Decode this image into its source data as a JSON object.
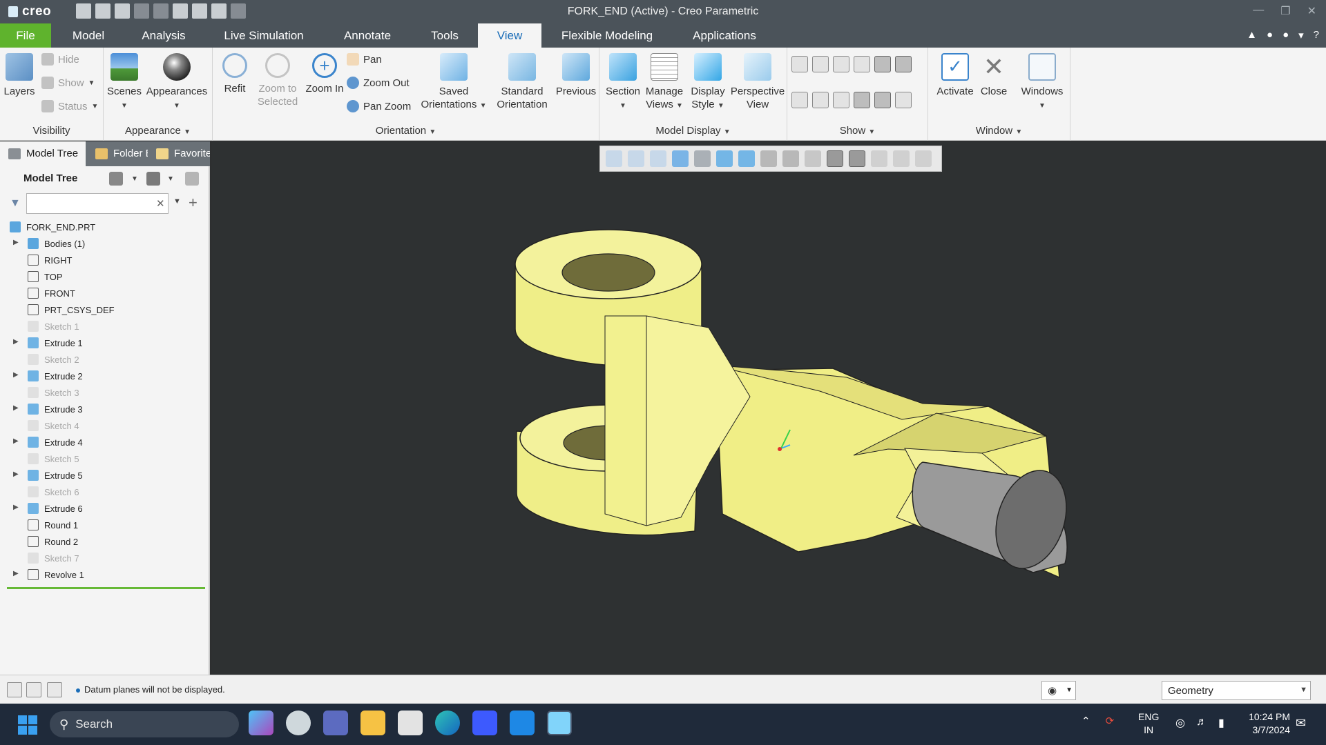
{
  "window": {
    "app_logo": "creo",
    "title": "FORK_END (Active) - Creo Parametric"
  },
  "ribbon_tabs": [
    {
      "label": "File"
    },
    {
      "label": "Model"
    },
    {
      "label": "Analysis"
    },
    {
      "label": "Live Simulation"
    },
    {
      "label": "Annotate"
    },
    {
      "label": "Tools"
    },
    {
      "label": "View"
    },
    {
      "label": "Flexible Modeling"
    },
    {
      "label": "Applications"
    }
  ],
  "active_tab": "View",
  "ribbon": {
    "visibility": {
      "group_label": "Visibility",
      "layers": "Layers",
      "hide": "Hide",
      "show": "Show",
      "status": "Status"
    },
    "appearance": {
      "group_label": "Appearance",
      "scenes": "Scenes",
      "appearances": "Appearances"
    },
    "orientation": {
      "group_label": "Orientation",
      "refit": "Refit",
      "zoom_to_selected_1": "Zoom to",
      "zoom_to_selected_2": "Selected",
      "zoom_in": "Zoom In",
      "pan": "Pan",
      "zoom_out": "Zoom Out",
      "pan_zoom": "Pan Zoom",
      "saved_orientations_1": "Saved",
      "saved_orientations_2": "Orientations",
      "standard_orientation_1": "Standard",
      "standard_orientation_2": "Orientation",
      "previous": "Previous"
    },
    "model_display": {
      "group_label": "Model Display",
      "section": "Section",
      "manage_views_1": "Manage",
      "manage_views_2": "Views",
      "display_style_1": "Display",
      "display_style_2": "Style",
      "perspective_view_1": "Perspective",
      "perspective_view_2": "View"
    },
    "show": {
      "group_label": "Show"
    },
    "window": {
      "group_label": "Window",
      "activate": "Activate",
      "close": "Close",
      "windows": "Windows"
    }
  },
  "tree_tabs": [
    {
      "label": "Model Tree"
    },
    {
      "label": "Folder Browser"
    },
    {
      "label": "Favorites"
    }
  ],
  "model_tree": {
    "header": "Model Tree",
    "search_placeholder": "",
    "items": [
      {
        "label": "FORK_END.PRT",
        "icon": "part-icon",
        "expandable": false,
        "suppressed": false
      },
      {
        "label": "Bodies (1)",
        "icon": "bodies-icon",
        "expandable": true,
        "suppressed": false
      },
      {
        "label": "RIGHT",
        "icon": "datum-plane-icon",
        "expandable": false,
        "suppressed": false
      },
      {
        "label": "TOP",
        "icon": "datum-plane-icon",
        "expandable": false,
        "suppressed": false
      },
      {
        "label": "FRONT",
        "icon": "datum-plane-icon",
        "expandable": false,
        "suppressed": false
      },
      {
        "label": "PRT_CSYS_DEF",
        "icon": "csys-icon",
        "expandable": false,
        "suppressed": false
      },
      {
        "label": "Sketch 1",
        "icon": "sketch-icon",
        "expandable": false,
        "suppressed": true
      },
      {
        "label": "Extrude 1",
        "icon": "extrude-icon",
        "expandable": true,
        "suppressed": false
      },
      {
        "label": "Sketch 2",
        "icon": "sketch-icon",
        "expandable": false,
        "suppressed": true
      },
      {
        "label": "Extrude 2",
        "icon": "extrude-icon",
        "expandable": true,
        "suppressed": false
      },
      {
        "label": "Sketch 3",
        "icon": "sketch-icon",
        "expandable": false,
        "suppressed": true
      },
      {
        "label": "Extrude 3",
        "icon": "extrude-icon",
        "expandable": true,
        "suppressed": false
      },
      {
        "label": "Sketch 4",
        "icon": "sketch-icon",
        "expandable": false,
        "suppressed": true
      },
      {
        "label": "Extrude 4",
        "icon": "extrude-icon",
        "expandable": true,
        "suppressed": false
      },
      {
        "label": "Sketch 5",
        "icon": "sketch-icon",
        "expandable": false,
        "suppressed": true
      },
      {
        "label": "Extrude 5",
        "icon": "extrude-icon",
        "expandable": true,
        "suppressed": false
      },
      {
        "label": "Sketch 6",
        "icon": "sketch-icon",
        "expandable": false,
        "suppressed": true
      },
      {
        "label": "Extrude 6",
        "icon": "extrude-icon",
        "expandable": true,
        "suppressed": false
      },
      {
        "label": "Round 1",
        "icon": "round-icon",
        "expandable": false,
        "suppressed": false
      },
      {
        "label": "Round 2",
        "icon": "round-icon",
        "expandable": false,
        "suppressed": false
      },
      {
        "label": "Sketch 7",
        "icon": "sketch-icon",
        "expandable": false,
        "suppressed": true
      },
      {
        "label": "Revolve 1",
        "icon": "revolve-icon",
        "expandable": true,
        "suppressed": false
      }
    ]
  },
  "status_bar": {
    "message": "Datum planes will not be displayed.",
    "filter_value": "Geometry"
  },
  "taskbar": {
    "search_label": "Search",
    "lang_1": "ENG",
    "lang_2": "IN",
    "time": "10:24 PM",
    "date": "3/7/2024"
  },
  "colors": {
    "accent_green": "#5fb32d",
    "model_yellow": "#f0ee86",
    "model_gray": "#9a9a9a",
    "viewport_bg": "#2e3132",
    "titlebar_bg": "#4b535a"
  }
}
